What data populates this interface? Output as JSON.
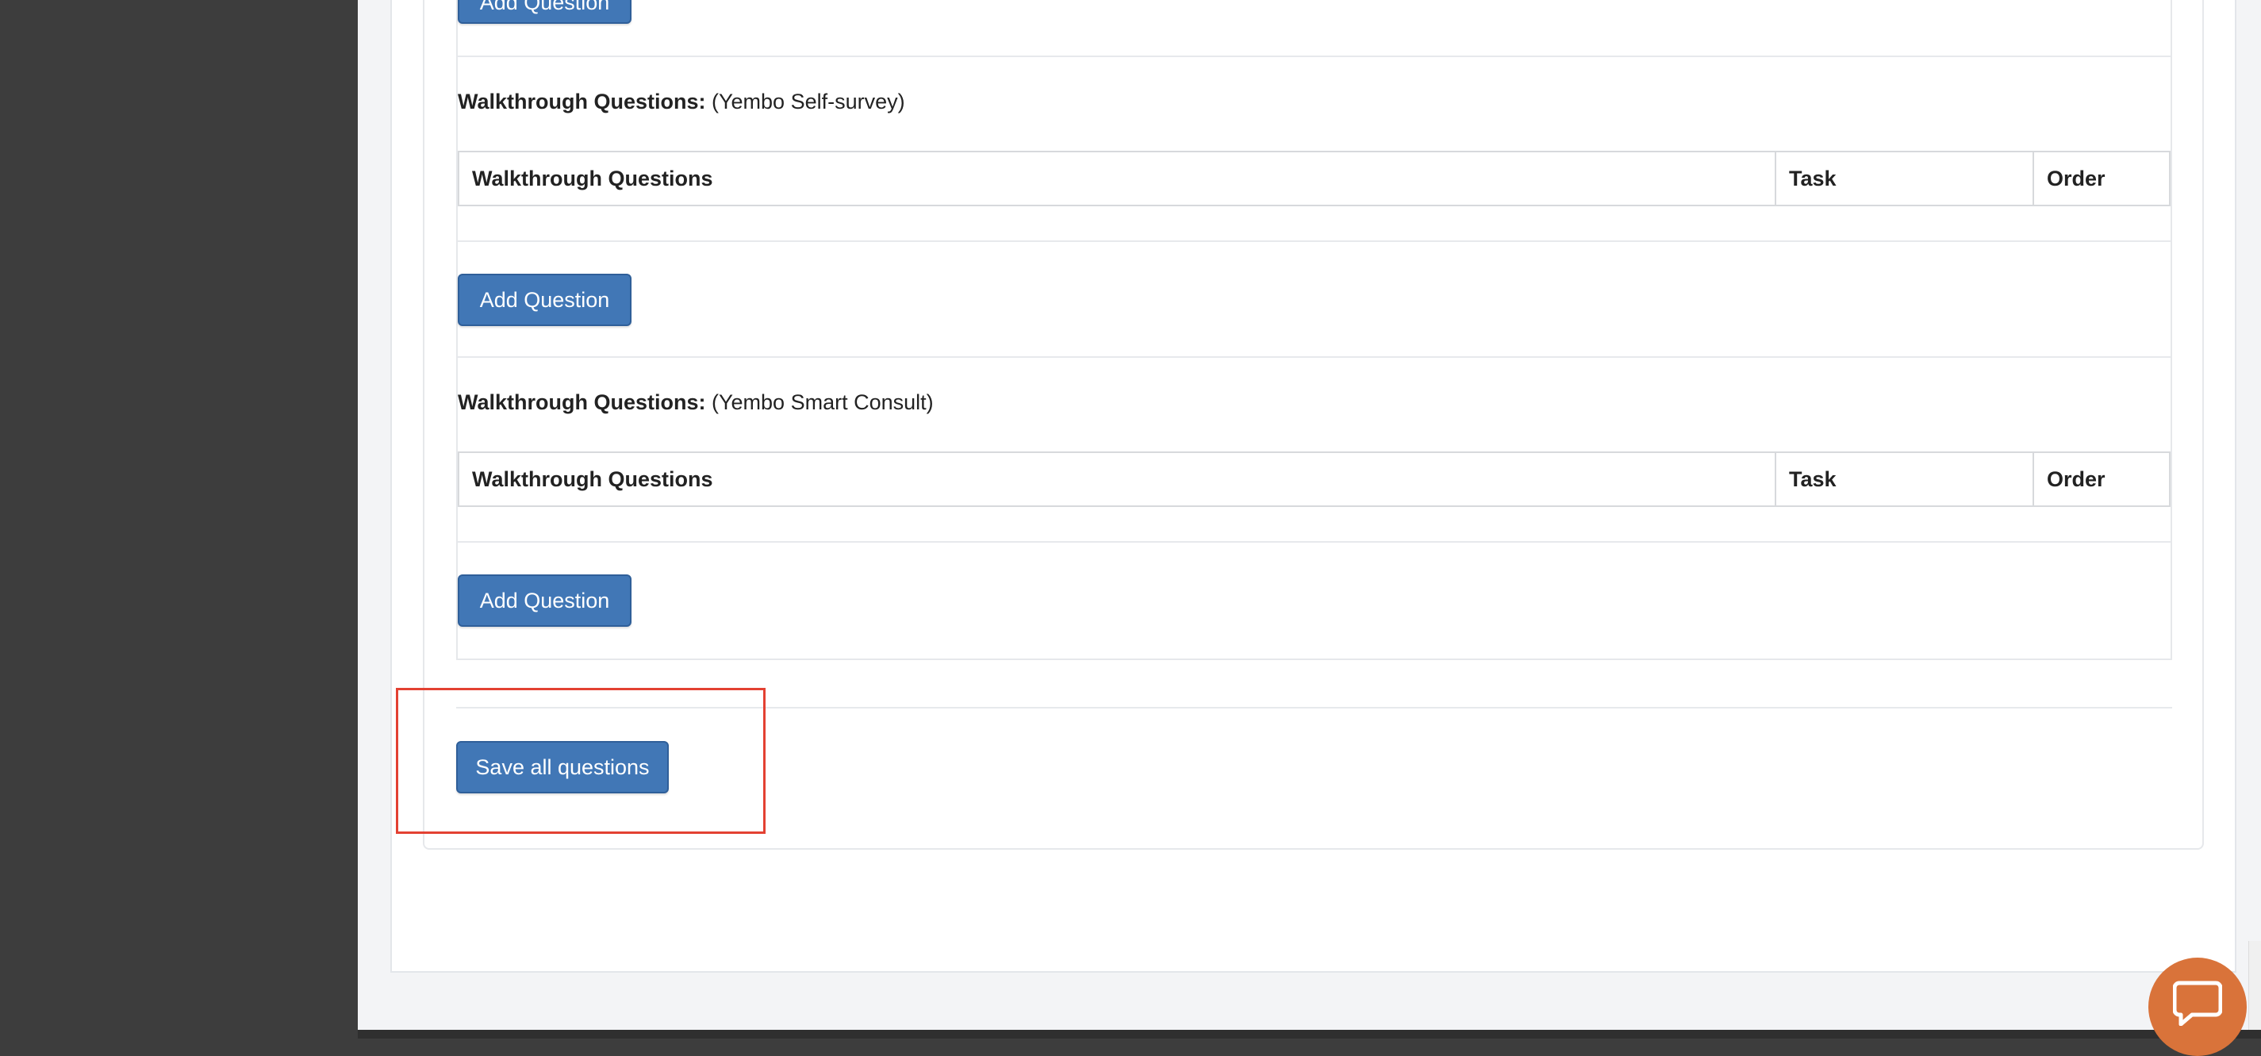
{
  "sections": [
    {
      "add_label": "Add Question"
    },
    {
      "title_bold": "Walkthrough Questions:",
      "title_suffix": " (Yembo Self-survey)",
      "columns": [
        "Walkthrough Questions",
        "Task",
        "Order"
      ],
      "add_label": "Add Question"
    },
    {
      "title_bold": "Walkthrough Questions:",
      "title_suffix": " (Yembo Smart Consult)",
      "columns": [
        "Walkthrough Questions",
        "Task",
        "Order"
      ],
      "add_label": "Add Question"
    }
  ],
  "save_label": "Save all questions",
  "colors": {
    "primary_button": "#4177b6",
    "highlight": "#e34132",
    "chat": "#d9733a",
    "sidebar": "#3d3d3d"
  },
  "icons": {
    "chat": "chat-bubble-icon"
  }
}
